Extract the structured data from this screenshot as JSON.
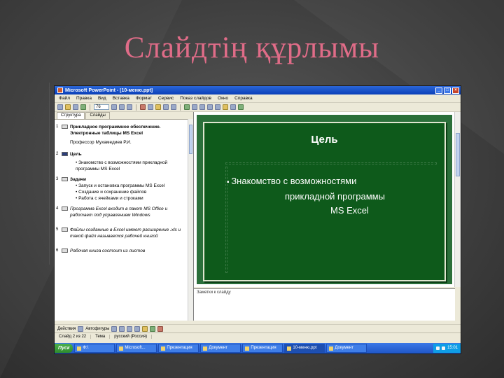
{
  "slide": {
    "title": "Слайдтің құрлымы"
  },
  "window": {
    "title": "Microsoft PowerPoint - [10-меню.ppt]"
  },
  "menubar": [
    "Файл",
    "Правка",
    "Вид",
    "Вставка",
    "Формат",
    "Сервис",
    "Показ слайдов",
    "Окно",
    "Справка"
  ],
  "toolbar": {
    "zoom": "76"
  },
  "outline": {
    "tabs": [
      "Структура",
      "Слайды"
    ],
    "items": [
      {
        "num": "1",
        "title": "Прикладное программное обеспечение. Электронные таблицы MS Excel",
        "lines": [
          "Профессор Мухамедиев Р.И."
        ]
      },
      {
        "num": "2",
        "title": "Цель",
        "bullets": [
          "Знакомство с возможностями прикладной программы MS Excel"
        ]
      },
      {
        "num": "3",
        "title": "Задачи",
        "bullets": [
          "Запуск и остановка программы MS Excel",
          "Создание и сохранение файлов",
          "Работа с ячейками и строками"
        ]
      },
      {
        "num": "4",
        "title": "Программа Excel входит в пакет MS Office и работает под управлением Windows",
        "italic": true
      },
      {
        "num": "5",
        "title": "Файлы созданные в Excel имеют расширение .xls и такой файл называется рабочей книгой",
        "italic": true
      },
      {
        "num": "6",
        "title": "Рабочая книга состоит из листов"
      }
    ]
  },
  "main_slide": {
    "title": "Цель",
    "body_line1": "Знакомство с возможностями",
    "body_line2": "прикладной программы",
    "body_line3": "MS Excel"
  },
  "notes": {
    "placeholder": "Заметки к слайду"
  },
  "bottom_toolbar": {
    "draw": "Действия",
    "autoshapes": "Автофигуры"
  },
  "statusbar": {
    "slide": "Слайд 2 из 22",
    "design": "Тема",
    "language": "русский (Россия)"
  },
  "taskbar": {
    "start": "Пуск",
    "tasks": [
      "Ф:\\",
      "Microsoft...",
      "Презентация",
      "Документ",
      "Презентация",
      "10-меню.ppt",
      "Документ"
    ],
    "clock": "15:01"
  },
  "colors": {
    "slide_bg": "#0e5a1b",
    "title_pink": "#e06c88",
    "xp_blue": "#2a66d8"
  }
}
